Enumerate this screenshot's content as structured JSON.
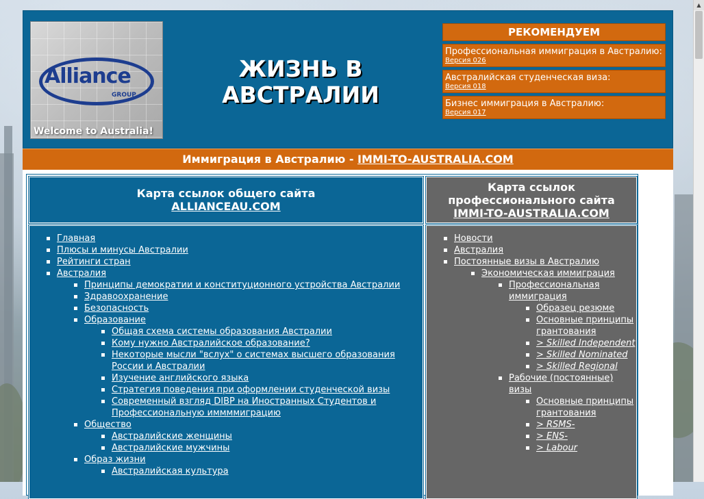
{
  "header": {
    "logo_text": "Alliance",
    "logo_group": "GROUP",
    "logo_welcome": "Welcome to Australia!",
    "site_title": "ЖИЗНЬ В АВСТРАЛИИ",
    "recommend": {
      "title": "РЕКОМЕНДУЕМ",
      "items": [
        {
          "text": "Профессиональная иммиграция в Австралию:",
          "version": "Версия 026"
        },
        {
          "text": "Австралийская студенческая виза:",
          "version": "Версия 018"
        },
        {
          "text": "Бизнес иммиграция в Австралию:",
          "version": "Версия 017"
        }
      ]
    }
  },
  "banner": {
    "text": "Иммиграция в Австралию - ",
    "link": "IMMI-TO-AUSTRALIA.COM"
  },
  "left": {
    "head_line1": "Карта ссылок общего сайта",
    "head_link": "ALLIANCEAU.COM",
    "items": [
      "Главная",
      "Плюсы и минусы Австралии",
      "Рейтинги стран",
      "Австралия"
    ],
    "australia_sub": [
      "Принципы демократии и конституционного устройства Австралии",
      "Здравоохранение",
      "Безопасность",
      "Образование"
    ],
    "education_sub": [
      "Общая схема системы образования Австралии",
      "Кому нужно Австралийское образование?",
      "Некоторые мысли \"вслух\" о системах высшего образования России и Австралии",
      "Изучение английского языка",
      "Стратегия поведения при оформлении студенческой визы",
      "Современный взгляд DIBP на Иностранных Студентов и Профессиональную иммммиграцию"
    ],
    "society": "Общество",
    "society_sub": [
      "Австралийские женщины",
      "Австралийские мужчины"
    ],
    "lifestyle": "Образ жизни",
    "lifestyle_sub": [
      "Австралийская культура"
    ]
  },
  "right": {
    "head_line1": "Карта ссылок профессионального сайта",
    "head_link": "IMMI-TO-AUSTRALIA.COM",
    "items": [
      "Новости",
      "Австралия",
      "Постоянные визы в Австралию"
    ],
    "econ": "Экономическая иммиграция",
    "prof": "Профессиональная иммиграция",
    "prof_sub": [
      "Образец резюме",
      "Основные принципы грантования",
      "> Skilled Independent",
      "> Skilled Nominated",
      "> Skilled Regional"
    ],
    "work": "Рабочие (постоянные) визы",
    "work_sub": [
      "Основные принципы грантования",
      "> RSMS-",
      "> ENS-",
      "> Labour"
    ]
  }
}
